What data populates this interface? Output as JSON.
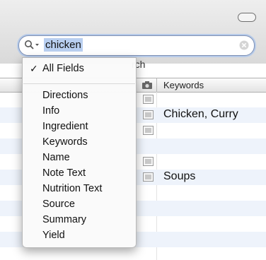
{
  "search": {
    "query": "chicken",
    "scope_label": "rch"
  },
  "table": {
    "keywords_header": "Keywords",
    "rows": [
      {
        "keywords": "",
        "has_icon": true
      },
      {
        "keywords": "Chicken, Curry",
        "has_icon": true
      },
      {
        "keywords": "",
        "has_icon": true
      },
      {
        "keywords": "",
        "has_icon": false
      },
      {
        "keywords": "",
        "has_icon": true
      },
      {
        "keywords": "Soups",
        "has_icon": true
      },
      {
        "keywords": "",
        "has_icon": false
      },
      {
        "keywords": "",
        "has_icon": false
      },
      {
        "keywords": "",
        "has_icon": false
      },
      {
        "keywords": "",
        "has_icon": false
      }
    ]
  },
  "menu": {
    "checkmark": "✓",
    "selected": "All Fields",
    "items": [
      "Directions",
      "Info",
      "Ingredient",
      "Keywords",
      "Name",
      "Note Text",
      "Nutrition Text",
      "Source",
      "Summary",
      "Yield"
    ]
  },
  "colors": {
    "selection": "#b9cff0",
    "focus_ring": "#b7cbe9",
    "alt_row": "#eef3fb"
  },
  "icons": {
    "search": "magnifier-with-dropdown-icon",
    "clear": "clear-circle-icon",
    "row": "photo-icon",
    "window": "toolbar-toggle-pill-icon"
  }
}
